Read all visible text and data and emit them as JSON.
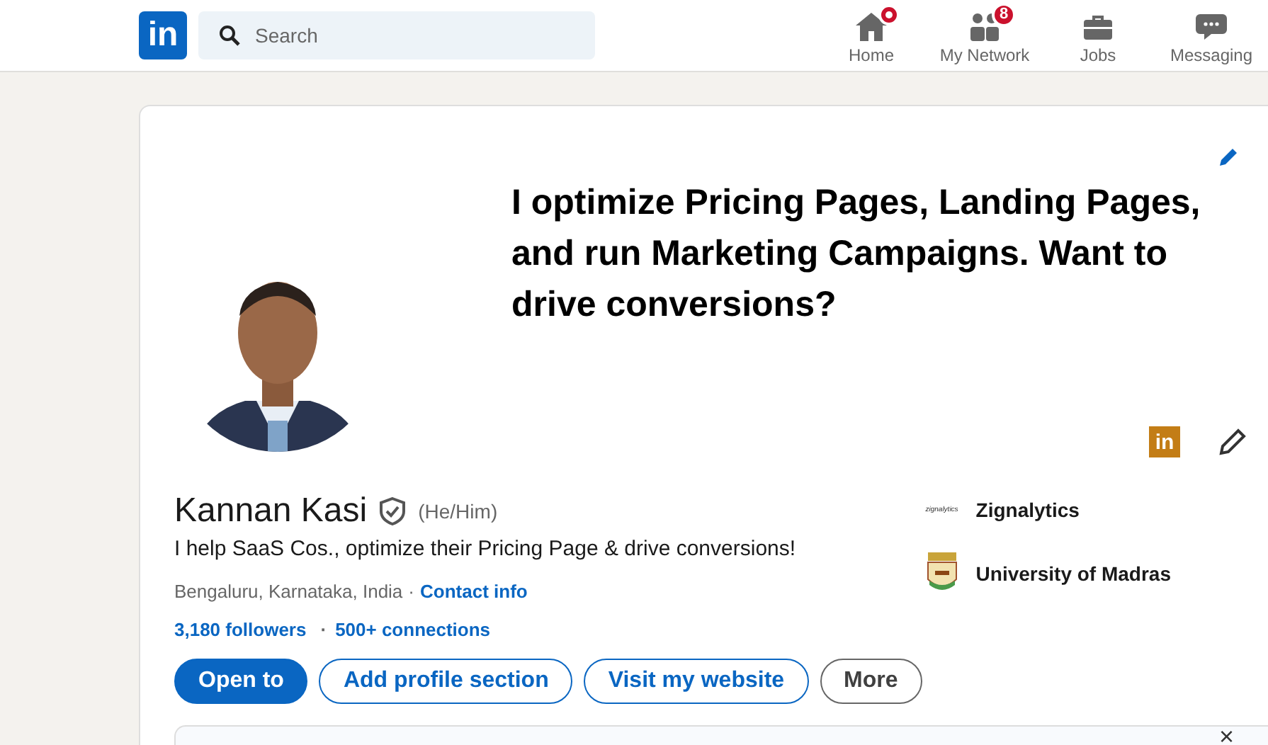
{
  "header": {
    "logo": "in",
    "search": {
      "placeholder": "Search"
    },
    "nav": [
      {
        "label": "Home",
        "kind": "home",
        "dot": true,
        "selected": false
      },
      {
        "label": "My Network",
        "kind": "network",
        "badge": "8",
        "dot": false,
        "selected": false
      },
      {
        "label": "Jobs",
        "kind": "jobs",
        "dot": false,
        "selected": false
      },
      {
        "label": "Messaging",
        "kind": "messaging",
        "dot": false,
        "selected": false
      }
    ]
  },
  "profile": {
    "banner_text": "I optimize Pricing Pages, Landing Pages, and run Marketing Campaigns. Want to drive conversions?",
    "badge_logo": "in",
    "name": "Kannan Kasi",
    "pronouns": "(He/Him)",
    "verified": true,
    "headline": "I help SaaS Cos., optimize their Pricing Page & drive conversions!",
    "location": "Bengaluru, Karnataka, India",
    "location_separator": "·",
    "contact_link": "Contact info",
    "followers": "3,180 followers",
    "connections_separator": "·",
    "connections": "500+ connections",
    "buttons": [
      {
        "label": "Open to",
        "kind": "primary"
      },
      {
        "label": "Add profile section",
        "kind": "outline"
      },
      {
        "label": "Visit my website",
        "kind": "outline"
      },
      {
        "label": "More",
        "kind": "neutral"
      }
    ],
    "experience": [
      {
        "logo": "zignalytics",
        "kind": "text",
        "name": "Zignalytics"
      },
      {
        "kind": "crest",
        "name": "University of Madras"
      }
    ]
  },
  "next_card": {
    "close": "×"
  }
}
